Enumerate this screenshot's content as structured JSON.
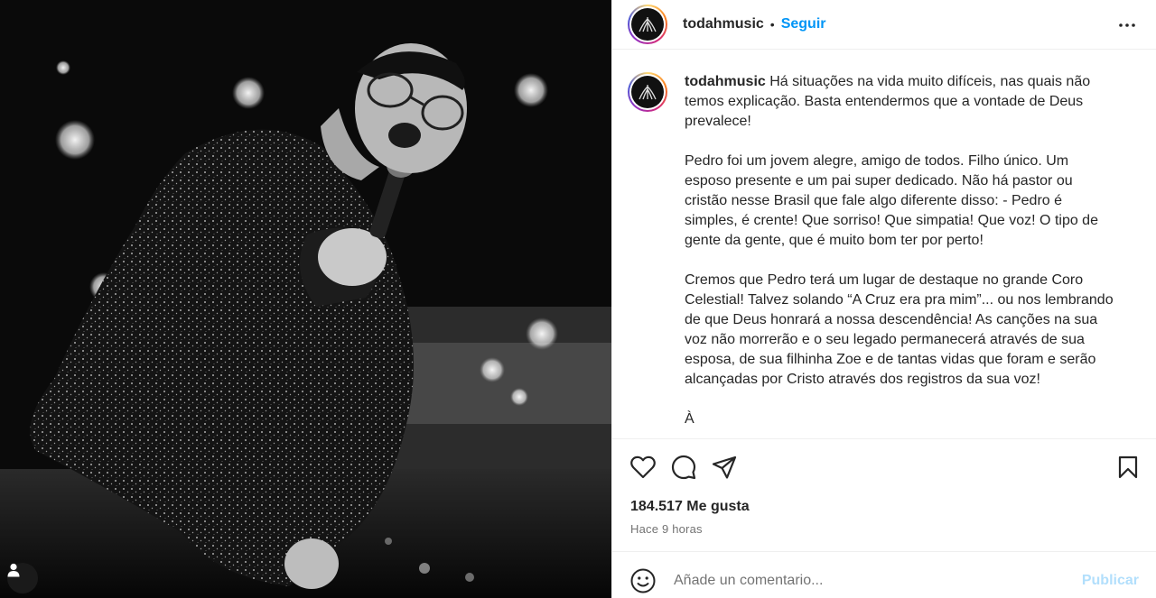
{
  "post": {
    "username": "todahmusic",
    "separator": "•",
    "follow_label": "Seguir",
    "caption_username": "todahmusic",
    "caption_paragraphs": [
      "Há situações na vida muito difíceis, nas quais não temos explicação. Basta entendermos que a vontade de Deus prevalece!",
      "Pedro foi um jovem alegre, amigo de todos. Filho único. Um esposo presente e um pai super dedicado. Não há pastor ou cristão nesse Brasil que fale algo diferente disso: - Pedro é simples, é crente! Que sorriso! Que simpatia! Que voz! O tipo de gente da gente, que é muito bom ter por perto!",
      "Cremos que Pedro terá um lugar de destaque no grande Coro Celestial! Talvez solando “A Cruz era pra mim”... ou nos lembrando de que Deus honrará a nossa descendência! As canções na sua voz não morrerão e o seu legado permanecerá através de sua esposa, de sua filhinha Zoe e de tantas vidas que foram e serão alcançadas por Cristo através dos registros da sua voz!",
      "À"
    ],
    "likes_label": "184.517 Me gusta",
    "time_label": "Hace 9 horas"
  },
  "comment": {
    "placeholder": "Añade un comentario...",
    "publish_label": "Publicar"
  },
  "icons": {
    "more": "more-options-icon",
    "like": "heart-icon",
    "comment": "comment-icon",
    "share": "share-icon",
    "save": "bookmark-icon",
    "emoji": "emoji-icon",
    "user_tag": "user-tag-icon"
  },
  "colors": {
    "accent": "#0095f6",
    "publish_disabled": "#b2dffc",
    "text": "#262626",
    "muted": "#737373"
  }
}
